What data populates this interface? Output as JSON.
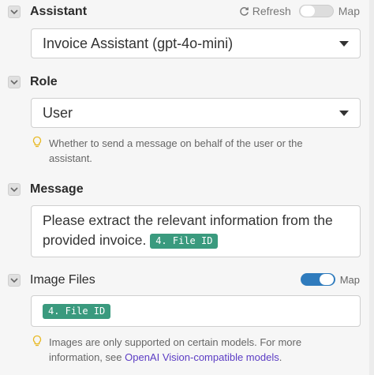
{
  "assistant": {
    "label": "Assistant",
    "refresh_label": "Refresh",
    "map_label": "Map",
    "selected": "Invoice Assistant (gpt-4o-mini)"
  },
  "role": {
    "label": "Role",
    "selected": "User",
    "hint": "Whether to send a message on behalf of the user or the assistant."
  },
  "message": {
    "label": "Message",
    "text": "Please extract the relevant information from the provided invoice.",
    "token": "4. File ID"
  },
  "image_files": {
    "label": "Image Files",
    "map_label": "Map",
    "map_enabled": true,
    "token": "4. File ID",
    "hint_prefix": "Images are only supported on certain models. For more information, see",
    "hint_link": "OpenAI Vision-compatible models",
    "hint_suffix": "."
  },
  "colors": {
    "accent": "#2f7bbd",
    "pill": "#3a9a7e",
    "link": "#5b3cc4"
  }
}
